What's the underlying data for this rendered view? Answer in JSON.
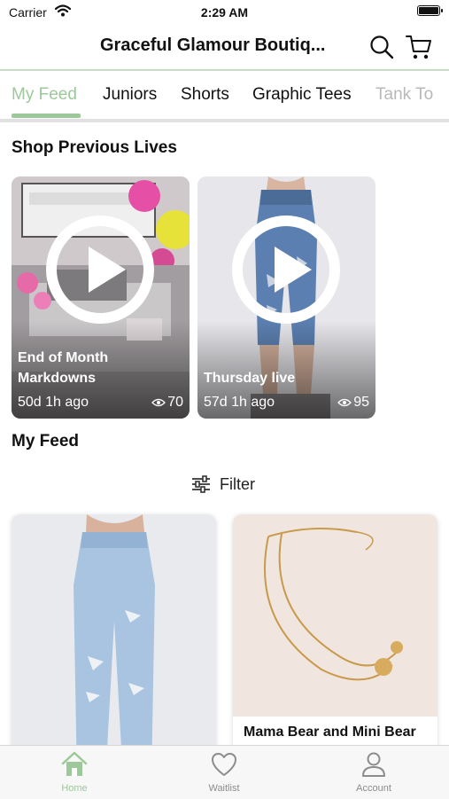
{
  "status_bar": {
    "carrier": "Carrier",
    "time": "2:29 AM"
  },
  "header": {
    "title": "Graceful Glamour Boutiq..."
  },
  "tabs": [
    {
      "label": "My Feed",
      "active": true
    },
    {
      "label": "Juniors"
    },
    {
      "label": "Shorts"
    },
    {
      "label": "Graphic Tees"
    },
    {
      "label": "Tank To"
    }
  ],
  "previous_lives": {
    "title": "Shop Previous Lives",
    "items": [
      {
        "title": "End of Month Markdowns",
        "age": "50d 1h ago",
        "views": "70"
      },
      {
        "title": "Thursday live",
        "age": "57d 1h ago",
        "views": "95"
      }
    ]
  },
  "feed": {
    "title": "My Feed",
    "filter_label": "Filter",
    "products": [
      {
        "name": ""
      },
      {
        "name": "Mama Bear and Mini Bear"
      }
    ]
  },
  "bottom_nav": [
    {
      "label": "Home",
      "icon": "home-icon",
      "active": true
    },
    {
      "label": "Waitlist",
      "icon": "heart-icon"
    },
    {
      "label": "Account",
      "icon": "person-icon"
    }
  ],
  "colors": {
    "accent": "#9cc89a",
    "text": "#111111"
  }
}
